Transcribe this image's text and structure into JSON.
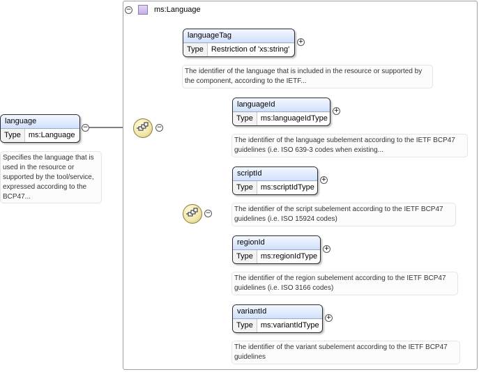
{
  "type_name": "ms:Language",
  "root": {
    "name": "language",
    "type_key": "Type",
    "type_value": "ms:Language",
    "doc": "Specifies the language that is used in the resource or supported by the tool/service, expressed according to the BCP47..."
  },
  "children": {
    "languageTag": {
      "name": "languageTag",
      "type_key": "Type",
      "type_value": "Restriction of 'xs:string'",
      "doc": "The identifier of the language that is included in the resource or supported by the component, according to the IETF..."
    },
    "languageId": {
      "name": "languageId",
      "type_key": "Type",
      "type_value": "ms:languageIdType",
      "doc": "The identifier of the language subelement according to the IETF BCP47 guidelines (i.e. ISO 639-3 codes when existing..."
    },
    "scriptId": {
      "name": "scriptId",
      "type_key": "Type",
      "type_value": "ms:scriptIdType",
      "doc": "The identifier of the script subelement according to the IETF BCP47 guidelines (i.e. ISO 15924 codes)"
    },
    "regionId": {
      "name": "regionId",
      "type_key": "Type",
      "type_value": "ms:regionIdType",
      "doc": "The identifier of the region subelement according to the IETF BCP47 guidelines (i.e. ISO 3166 codes)"
    },
    "variantId": {
      "name": "variantId",
      "type_key": "Type",
      "type_value": "ms:variantIdType",
      "doc": "The identifier of the variant subelement according to the IETF BCP47 guidelines"
    }
  },
  "symbols": {
    "collapse": "−",
    "expand": "+"
  },
  "colors": {
    "header_gradient_top": "#f4f8ff",
    "header_gradient_bottom": "#cfe0fb",
    "compositor": "#f0e6a8"
  }
}
